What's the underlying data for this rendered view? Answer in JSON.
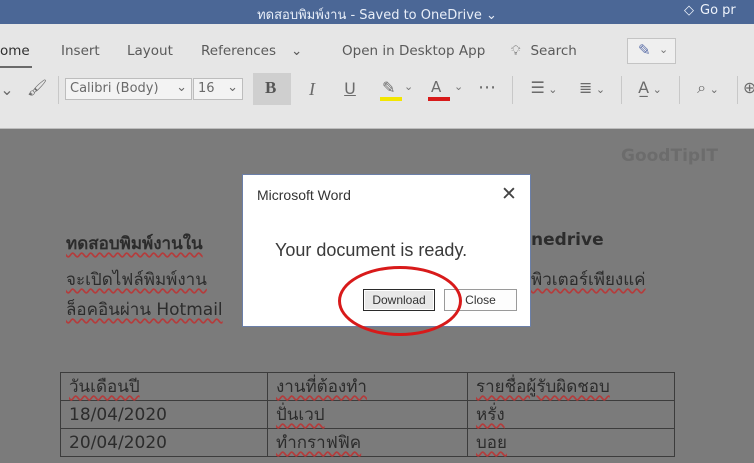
{
  "window": {
    "title": "ทดสอบพิมพ์งาน - Saved to OneDrive ⌄",
    "go_premium": "Go pr",
    "brand_color": "#4b6796"
  },
  "ribbon": {
    "tabs": [
      "ome",
      "Insert",
      "Layout",
      "References",
      "⌄",
      "Open in Desktop App",
      "Search"
    ],
    "font_name": "Calibri (Body)",
    "font_size": "16"
  },
  "watermark": "GoodTipIT",
  "document": {
    "heading_left": "ทดสอบพิมพ์งานใน",
    "heading_right": "nedrive",
    "line1_left": "จะเปิดไฟล์พิมพ์งาน",
    "line1_right": "พิวเตอร์เพียงแค่",
    "line2": "ล็อคอินผ่าน Hotmail",
    "table": [
      [
        "วันเดือนปี",
        "งานที่ต้องทำ",
        "รายชื่อผู้รับผิดชอบ"
      ],
      [
        "18/04/2020",
        "ปั่นเวป",
        "หรั่ง"
      ],
      [
        "20/04/2020",
        "ทำกราฟฟิค",
        "บอย"
      ]
    ]
  },
  "dialog": {
    "title": "Microsoft Word",
    "message": "Your document is ready.",
    "download_label": "Download",
    "close_label": "Close",
    "highlight_color": "#d81a1a"
  }
}
